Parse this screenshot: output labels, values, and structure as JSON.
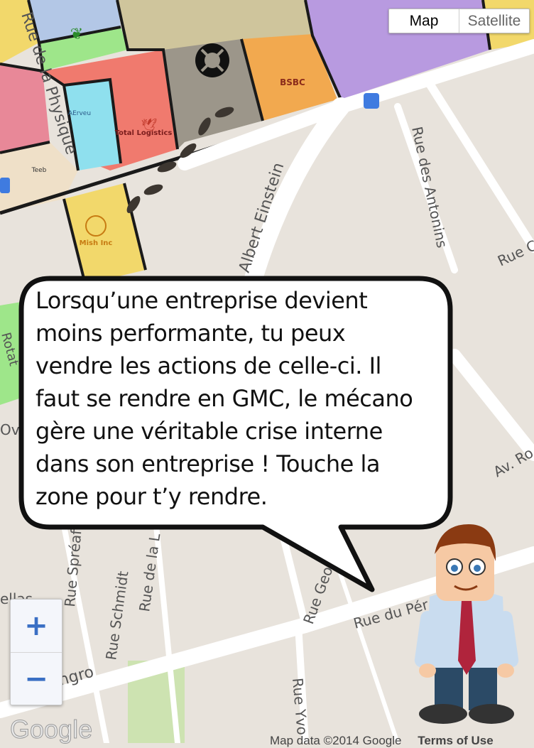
{
  "map": {
    "type_control": {
      "map_label": "Map",
      "satellite_label": "Satellite"
    },
    "zoom": {
      "in_label": "+",
      "out_label": "−"
    },
    "logo": "Google",
    "attribution": {
      "data": "Map data ©2014 Google",
      "terms": "Terms of Use"
    },
    "streets": [
      "Rue de la Physique",
      "Albert Einstein",
      "Rue des Antonins",
      "Rue C",
      "Av. Ro",
      "Rue du Pér",
      "Rue Georg",
      "Rue Spréafi",
      "Rue de la L",
      "Rue Schmidt",
      "Rue Yvo",
      "ngro",
      "ellas",
      "Ove",
      "Rotat"
    ],
    "pois": [
      "Total Logistics",
      "Mish Inc",
      "BSBC",
      "Teeb",
      "AErveu"
    ],
    "colors": {
      "orange": "#f2a94f",
      "gold": "#f2d86b",
      "salmon": "#f07a6e",
      "cyan": "#8fe0ee",
      "green": "#9ee68a",
      "lavender": "#b89ae0",
      "tan": "#cfc59c",
      "gray": "#9c968a",
      "pink": "#e88898"
    }
  },
  "bubble": {
    "lines": [
      "Lorsqu’une entreprise devient",
      "moins performante, tu peux",
      "vendre les actions de celle-ci. Il",
      "faut se rendre en GMC, le mécano",
      "gère une véritable crise interne",
      "dans son entreprise ! Touche la",
      "zone pour t’y rendre."
    ]
  }
}
